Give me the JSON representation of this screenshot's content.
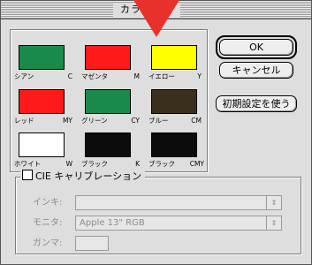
{
  "window": {
    "title": "カラー設定"
  },
  "swatches": [
    {
      "name": "シアン",
      "code": "C",
      "color": "#1a8a4a"
    },
    {
      "name": "マゼンタ",
      "code": "M",
      "color": "#ff1a1a"
    },
    {
      "name": "イエロー",
      "code": "Y",
      "color": "#ffff00"
    },
    {
      "name": "レッド",
      "code": "MY",
      "color": "#ff1a1a"
    },
    {
      "name": "グリーン",
      "code": "CY",
      "color": "#1a8a4a"
    },
    {
      "name": "ブルー",
      "code": "CM",
      "color": "#3a2f1c"
    },
    {
      "name": "ホワイト",
      "code": "W",
      "color": "#ffffff"
    },
    {
      "name": "ブラック",
      "code": "K",
      "color": "#0c0c0c"
    },
    {
      "name": "ブラック",
      "code": "CMY",
      "color": "#0c0c0c"
    }
  ],
  "buttons": {
    "ok": "OK",
    "cancel": "キャンセル",
    "defaults": "初期設定を使う"
  },
  "cie": {
    "checkbox_label": "CIE キャリブレーション",
    "checked": false,
    "ink_label": "インキ:",
    "ink_value": "",
    "monitor_label": "モニタ:",
    "monitor_value": "Apple 13\" RGB",
    "gamma_label": "ガンマ:",
    "gamma_value": ""
  },
  "pointer": {
    "icon": "red-arrow-pointer-icon",
    "color": "#e8312a"
  }
}
